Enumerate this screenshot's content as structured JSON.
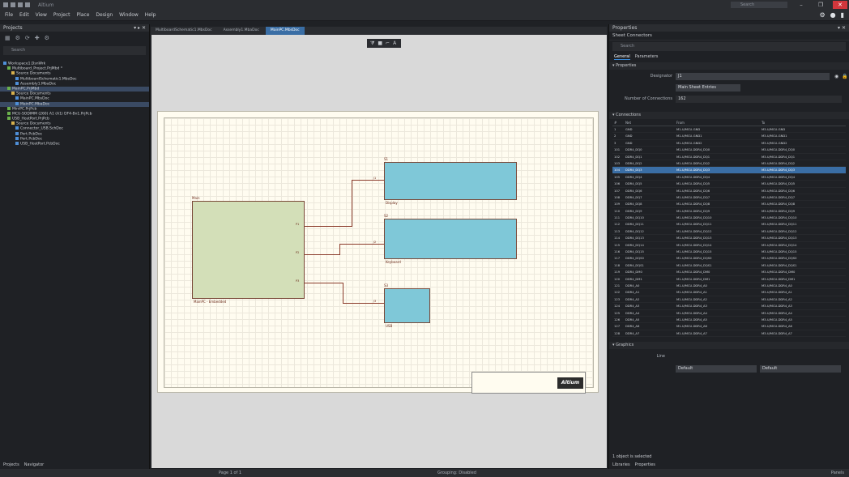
{
  "app": {
    "title": "Altium",
    "search_placeholder": "Search",
    "window_buttons": [
      "–",
      "❐",
      "✕"
    ]
  },
  "menu": {
    "items": [
      "File",
      "Edit",
      "View",
      "Project",
      "Place",
      "Design",
      "Window",
      "Help"
    ],
    "right_icons": [
      "gear-icon",
      "bell-icon",
      "user-icon"
    ]
  },
  "projects_panel": {
    "title": "Projects",
    "header_controls": "▾ ▸ ✕",
    "search_placeholder": "Search",
    "tree": [
      {
        "label": "Workspace1.DsnWrk",
        "color": "#4f8fd8",
        "indent": 0,
        "selected": false
      },
      {
        "label": "Multiboard_Project.PrjMbd *",
        "color": "#6ab04c",
        "indent": 1,
        "selected": false
      },
      {
        "label": "Source Documents",
        "color": "#d8b04c",
        "indent": 2,
        "selected": false
      },
      {
        "label": "MultiboardSchematic1.MbsDoc",
        "color": "#4f8fd8",
        "indent": 3,
        "selected": false
      },
      {
        "label": "Assembly1.MbaDoc",
        "color": "#4f8fd8",
        "indent": 3,
        "selected": false
      },
      {
        "label": "MainPC.PrjMbd",
        "color": "#6ab04c",
        "indent": 1,
        "selected": true
      },
      {
        "label": "Source Documents",
        "color": "#d8b04c",
        "indent": 2,
        "selected": false
      },
      {
        "label": "MainPC.MbsDoc",
        "color": "#4f8fd8",
        "indent": 3,
        "selected": false
      },
      {
        "label": "MainPC.MbaDoc",
        "color": "#4f8fd8",
        "indent": 3,
        "selected": true
      },
      {
        "label": "MiniPC.PrjPcb",
        "color": "#6ab04c",
        "indent": 1,
        "selected": false
      },
      {
        "label": "MCU-SODIMM (260) A1 (A1) DF4-Bn1.PrjPcb",
        "color": "#6ab04c",
        "indent": 1,
        "selected": false
      },
      {
        "label": "USB_HostPort.PrjPcb",
        "color": "#6ab04c",
        "indent": 1,
        "selected": false
      },
      {
        "label": "Source Documents",
        "color": "#d8b04c",
        "indent": 2,
        "selected": false
      },
      {
        "label": "Connector_USB.SchDoc",
        "color": "#4f8fd8",
        "indent": 3,
        "selected": false
      },
      {
        "label": "Port.PcbDoc",
        "color": "#4f8fd8",
        "indent": 3,
        "selected": false
      },
      {
        "label": "Port.PcbDoc",
        "color": "#4f8fd8",
        "indent": 3,
        "selected": false
      },
      {
        "label": "USB_HostPort.PcbDoc",
        "color": "#4f8fd8",
        "indent": 3,
        "selected": false
      }
    ],
    "bottom_tabs": [
      "Projects",
      "Navigator"
    ]
  },
  "document_tabs": [
    {
      "label": "MultiboardSchematic1.MbsDoc",
      "active": false
    },
    {
      "label": "Assembly1.MbaDoc",
      "active": false
    },
    {
      "label": "MainPC.MbsDoc",
      "active": true
    }
  ],
  "schematic": {
    "blocks": [
      {
        "name": "Main",
        "designator": "MainPC - Embedded",
        "color": "green"
      },
      {
        "name": "S1",
        "designator": "Display",
        "color": "blue"
      },
      {
        "name": "S2",
        "designator": "Keyboard",
        "color": "blue"
      },
      {
        "name": "S3",
        "designator": "USB",
        "color": "blue"
      }
    ],
    "ports": [
      "P1",
      "P2",
      "P3",
      "P4",
      "J1",
      "J2",
      "J3"
    ],
    "logo": "Altium"
  },
  "properties_panel": {
    "title": "Properties",
    "header_controls": "▾ ✕",
    "subtitle": "Sheet Connectors",
    "search_placeholder": "Search",
    "tabs": [
      {
        "label": "General",
        "active": true
      },
      {
        "label": "Parameters",
        "active": false
      }
    ],
    "properties_section": "Properties",
    "properties": [
      {
        "label": "Designator",
        "value": "J1"
      },
      {
        "label": "",
        "value": "Main Sheet Entries"
      },
      {
        "label": "Number of Connections",
        "value": "162"
      }
    ],
    "connections_section": "Connections",
    "connections_header": {
      "idx": "#",
      "net": "Net",
      "from": "From",
      "to": "To"
    },
    "connections": [
      {
        "idx": "1",
        "net": "GND",
        "from": "M1-U/MCU-GND",
        "to": "M3-U/MCU-GND",
        "selected": false
      },
      {
        "idx": "2",
        "net": "GND",
        "from": "M1-U/MCU-GND1",
        "to": "M3-U/MCU-GND1",
        "selected": false
      },
      {
        "idx": "3",
        "net": "GND",
        "from": "M1-U/MCU-GND2",
        "to": "M3-U/MCU-GND2",
        "selected": false
      },
      {
        "idx": "101",
        "net": "DDR4_DQ0",
        "from": "M1-U/MCU-DDR4_DQ0",
        "to": "M3-U/MCU-DDR4_DQ0",
        "selected": false
      },
      {
        "idx": "102",
        "net": "DDR4_DQ1",
        "from": "M1-U/MCU-DDR4_DQ1",
        "to": "M3-U/MCU-DDR4_DQ1",
        "selected": false
      },
      {
        "idx": "103",
        "net": "DDR4_DQ2",
        "from": "M1-U/MCU-DDR4_DQ2",
        "to": "M3-U/MCU-DDR4_DQ2",
        "selected": false
      },
      {
        "idx": "104",
        "net": "DDR4_DQ3",
        "from": "M1-U/MCU-DDR4_DQ3",
        "to": "M3-U/MCU-DDR4_DQ3",
        "selected": true
      },
      {
        "idx": "105",
        "net": "DDR4_DQ4",
        "from": "M1-U/MCU-DDR4_DQ4",
        "to": "M3-U/MCU-DDR4_DQ4",
        "selected": false
      },
      {
        "idx": "106",
        "net": "DDR4_DQ5",
        "from": "M1-U/MCU-DDR4_DQ5",
        "to": "M3-U/MCU-DDR4_DQ5",
        "selected": false
      },
      {
        "idx": "107",
        "net": "DDR4_DQ6",
        "from": "M1-U/MCU-DDR4_DQ6",
        "to": "M3-U/MCU-DDR4_DQ6",
        "selected": false
      },
      {
        "idx": "108",
        "net": "DDR4_DQ7",
        "from": "M1-U/MCU-DDR4_DQ7",
        "to": "M3-U/MCU-DDR4_DQ7",
        "selected": false
      },
      {
        "idx": "109",
        "net": "DDR4_DQ8",
        "from": "M1-U/MCU-DDR4_DQ8",
        "to": "M3-U/MCU-DDR4_DQ8",
        "selected": false
      },
      {
        "idx": "110",
        "net": "DDR4_DQ9",
        "from": "M1-U/MCU-DDR4_DQ9",
        "to": "M3-U/MCU-DDR4_DQ9",
        "selected": false
      },
      {
        "idx": "111",
        "net": "DDR4_DQ10",
        "from": "M1-U/MCU-DDR4_DQ10",
        "to": "M3-U/MCU-DDR4_DQ10",
        "selected": false
      },
      {
        "idx": "112",
        "net": "DDR4_DQ11",
        "from": "M1-U/MCU-DDR4_DQ11",
        "to": "M3-U/MCU-DDR4_DQ11",
        "selected": false
      },
      {
        "idx": "113",
        "net": "DDR4_DQ12",
        "from": "M1-U/MCU-DDR4_DQ12",
        "to": "M3-U/MCU-DDR4_DQ12",
        "selected": false
      },
      {
        "idx": "114",
        "net": "DDR4_DQ13",
        "from": "M1-U/MCU-DDR4_DQ13",
        "to": "M3-U/MCU-DDR4_DQ13",
        "selected": false
      },
      {
        "idx": "115",
        "net": "DDR4_DQ14",
        "from": "M1-U/MCU-DDR4_DQ14",
        "to": "M3-U/MCU-DDR4_DQ14",
        "selected": false
      },
      {
        "idx": "116",
        "net": "DDR4_DQ15",
        "from": "M1-U/MCU-DDR4_DQ15",
        "to": "M3-U/MCU-DDR4_DQ15",
        "selected": false
      },
      {
        "idx": "117",
        "net": "DDR4_DQS0",
        "from": "M1-U/MCU-DDR4_DQS0",
        "to": "M3-U/MCU-DDR4_DQS0",
        "selected": false
      },
      {
        "idx": "118",
        "net": "DDR4_DQS1",
        "from": "M1-U/MCU-DDR4_DQS1",
        "to": "M3-U/MCU-DDR4_DQS1",
        "selected": false
      },
      {
        "idx": "119",
        "net": "DDR4_DM0",
        "from": "M1-U/MCU-DDR4_DM0",
        "to": "M3-U/MCU-DDR4_DM0",
        "selected": false
      },
      {
        "idx": "120",
        "net": "DDR4_DM1",
        "from": "M1-U/MCU-DDR4_DM1",
        "to": "M3-U/MCU-DDR4_DM1",
        "selected": false
      },
      {
        "idx": "121",
        "net": "DDR4_A0",
        "from": "M1-U/MCU-DDR4_A0",
        "to": "M3-U/MCU-DDR4_A0",
        "selected": false
      },
      {
        "idx": "122",
        "net": "DDR4_A1",
        "from": "M1-U/MCU-DDR4_A1",
        "to": "M3-U/MCU-DDR4_A1",
        "selected": false
      },
      {
        "idx": "123",
        "net": "DDR4_A2",
        "from": "M1-U/MCU-DDR4_A2",
        "to": "M3-U/MCU-DDR4_A2",
        "selected": false
      },
      {
        "idx": "124",
        "net": "DDR4_A3",
        "from": "M1-U/MCU-DDR4_A3",
        "to": "M3-U/MCU-DDR4_A3",
        "selected": false
      },
      {
        "idx": "125",
        "net": "DDR4_A4",
        "from": "M1-U/MCU-DDR4_A4",
        "to": "M3-U/MCU-DDR4_A4",
        "selected": false
      },
      {
        "idx": "126",
        "net": "DDR4_A5",
        "from": "M1-U/MCU-DDR4_A5",
        "to": "M3-U/MCU-DDR4_A5",
        "selected": false
      },
      {
        "idx": "127",
        "net": "DDR4_A6",
        "from": "M1-U/MCU-DDR4_A6",
        "to": "M3-U/MCU-DDR4_A6",
        "selected": false
      },
      {
        "idx": "128",
        "net": "DDR4_A7",
        "from": "M1-U/MCU-DDR4_A7",
        "to": "M3-U/MCU-DDR4_A7",
        "selected": false
      }
    ],
    "graphics_section": "Graphics",
    "graphics_label": "Line",
    "graphics_selects": [
      "Default",
      "Default"
    ],
    "bottom_section": "1 object is selected",
    "bottom_tabs": [
      "Libraries",
      "Properties"
    ]
  },
  "status": {
    "left": "",
    "mid": "Page 1 of 1",
    "mid2": "Grouping: Disabled",
    "right": "Panels"
  }
}
